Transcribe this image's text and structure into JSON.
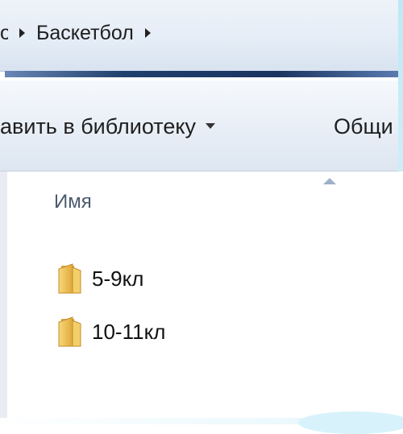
{
  "breadcrumb": {
    "items": [
      {
        "label": "о"
      },
      {
        "label": "Баскетбол"
      }
    ]
  },
  "toolbar": {
    "library_label": "авить в библиотеку",
    "share_label": "Общи"
  },
  "file_list": {
    "column_name": "Имя",
    "items": [
      {
        "name": "5-9кл",
        "icon": "folder-icon"
      },
      {
        "name": "10-11кл",
        "icon": "folder-icon"
      }
    ]
  },
  "colors": {
    "address_bar_bg": "#e4ecf6",
    "accent_stripe": "#1b3560",
    "toolbar_bg": "#e8eef6",
    "folder_yellow": "#f2c64c",
    "frame_cyan": "#c6ecf8"
  }
}
